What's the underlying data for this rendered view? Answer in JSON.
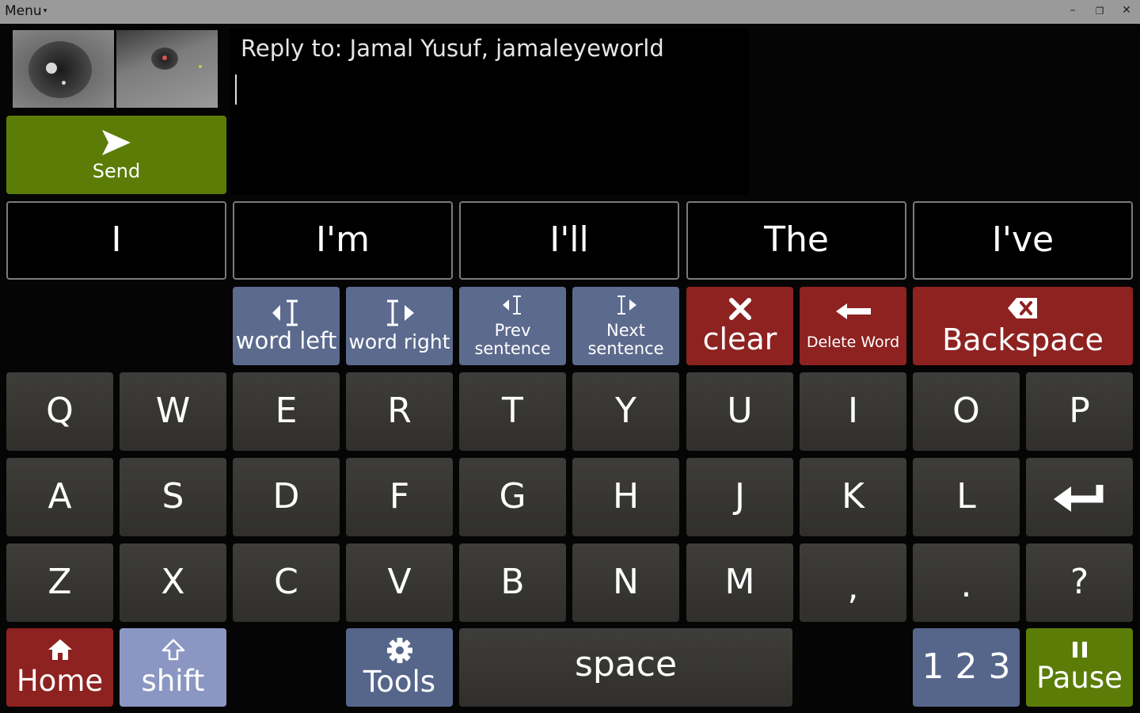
{
  "titlebar": {
    "menu_label": "Menu",
    "menu_caret": "▾",
    "minimize_glyph": "–",
    "restore_glyph": "❐",
    "close_glyph": "✕",
    "background": "#9a9a9a"
  },
  "message": {
    "reply_to": "Reply to: Jamal Yusuf, jamaleyeworld",
    "text": ""
  },
  "send_button": {
    "label": "Send",
    "icon": "send-icon",
    "color": "#5b7d08"
  },
  "predictions": [
    "I",
    "I'm",
    "I'll",
    "The",
    "I've"
  ],
  "nav_keys": {
    "word_left": {
      "label": "word left",
      "icon": "cursor-left-icon"
    },
    "word_right": {
      "label": "word right",
      "icon": "cursor-right-icon"
    },
    "prev_sentence": {
      "line1": "Prev",
      "line2": "sentence",
      "icon": "cursor-left-icon"
    },
    "next_sentence": {
      "line1": "Next",
      "line2": "sentence",
      "icon": "cursor-right-icon"
    }
  },
  "edit_keys": {
    "clear": {
      "label": "clear",
      "icon": "x-icon"
    },
    "delete_word": {
      "label": "Delete Word",
      "icon": "arrow-left-icon"
    },
    "backspace": {
      "label": "Backspace",
      "icon": "backspace-icon"
    }
  },
  "keyboard": {
    "row1": [
      "Q",
      "W",
      "E",
      "R",
      "T",
      "Y",
      "U",
      "I",
      "O",
      "P"
    ],
    "row2": [
      "A",
      "S",
      "D",
      "F",
      "G",
      "H",
      "J",
      "K",
      "L"
    ],
    "row3": [
      "Z",
      "X",
      "C",
      "V",
      "B",
      "N",
      "M",
      ",",
      ".",
      "?"
    ]
  },
  "bottom_keys": {
    "home": {
      "label": "Home",
      "icon": "home-icon"
    },
    "shift": {
      "label": "shift",
      "icon": "shift-arrow-icon"
    },
    "tools": {
      "label": "Tools",
      "icon": "gear-icon"
    },
    "space": {
      "label": "space"
    },
    "numbers": {
      "label": "1 2 3"
    },
    "pause": {
      "label": "Pause",
      "icon": "pause-icon"
    }
  },
  "colors": {
    "letter_key": "#383734",
    "nav_key": "#5b6a8d",
    "red_key": "#8d2221",
    "green_key": "#5b7d08",
    "shift_key": "#8b97c2",
    "background": "#050505"
  }
}
